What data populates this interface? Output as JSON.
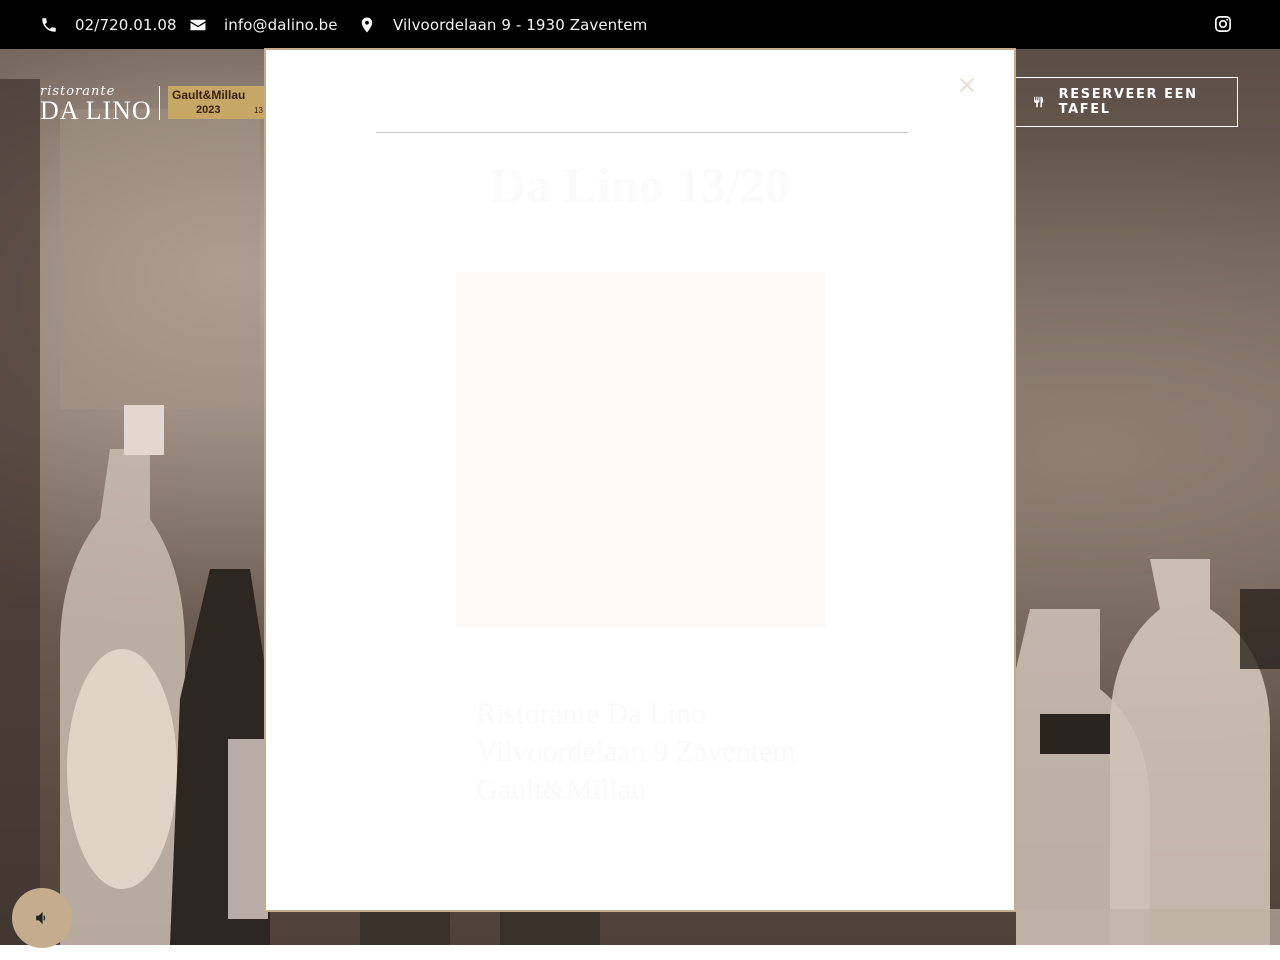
{
  "topbar": {
    "phone": "02/720.01.08",
    "email": "info@dalino.be",
    "address": "Vilvoordelaan 9 - 1930 Zaventem",
    "phone_icon": "phone-icon",
    "email_icon": "envelope-icon",
    "address_icon": "map-marker-icon",
    "social_icon": "instagram-icon"
  },
  "header": {
    "logo_script": "ristorante",
    "logo_main": "DA LINO",
    "badge_title": "Gault&Millau",
    "badge_year": "2023",
    "badge_score": "13",
    "reserve_label": "RESERVEER EEN TAFEL",
    "reserve_icon": "utensils-icon"
  },
  "modal": {
    "title": "Da Lino 13/20",
    "body_lines": [
      "Ristorante Da Lino",
      "Vilvoordelaan 9 Zaventem",
      "Gault&Millau"
    ],
    "close_icon": "close-icon"
  },
  "sound_button": {
    "icon": "volume-icon"
  },
  "colors": {
    "topbar_bg": "#000000",
    "accent_gold": "#c4ad8c",
    "badge_gold": "#c6a765",
    "modal_bg": "#ffffff"
  }
}
